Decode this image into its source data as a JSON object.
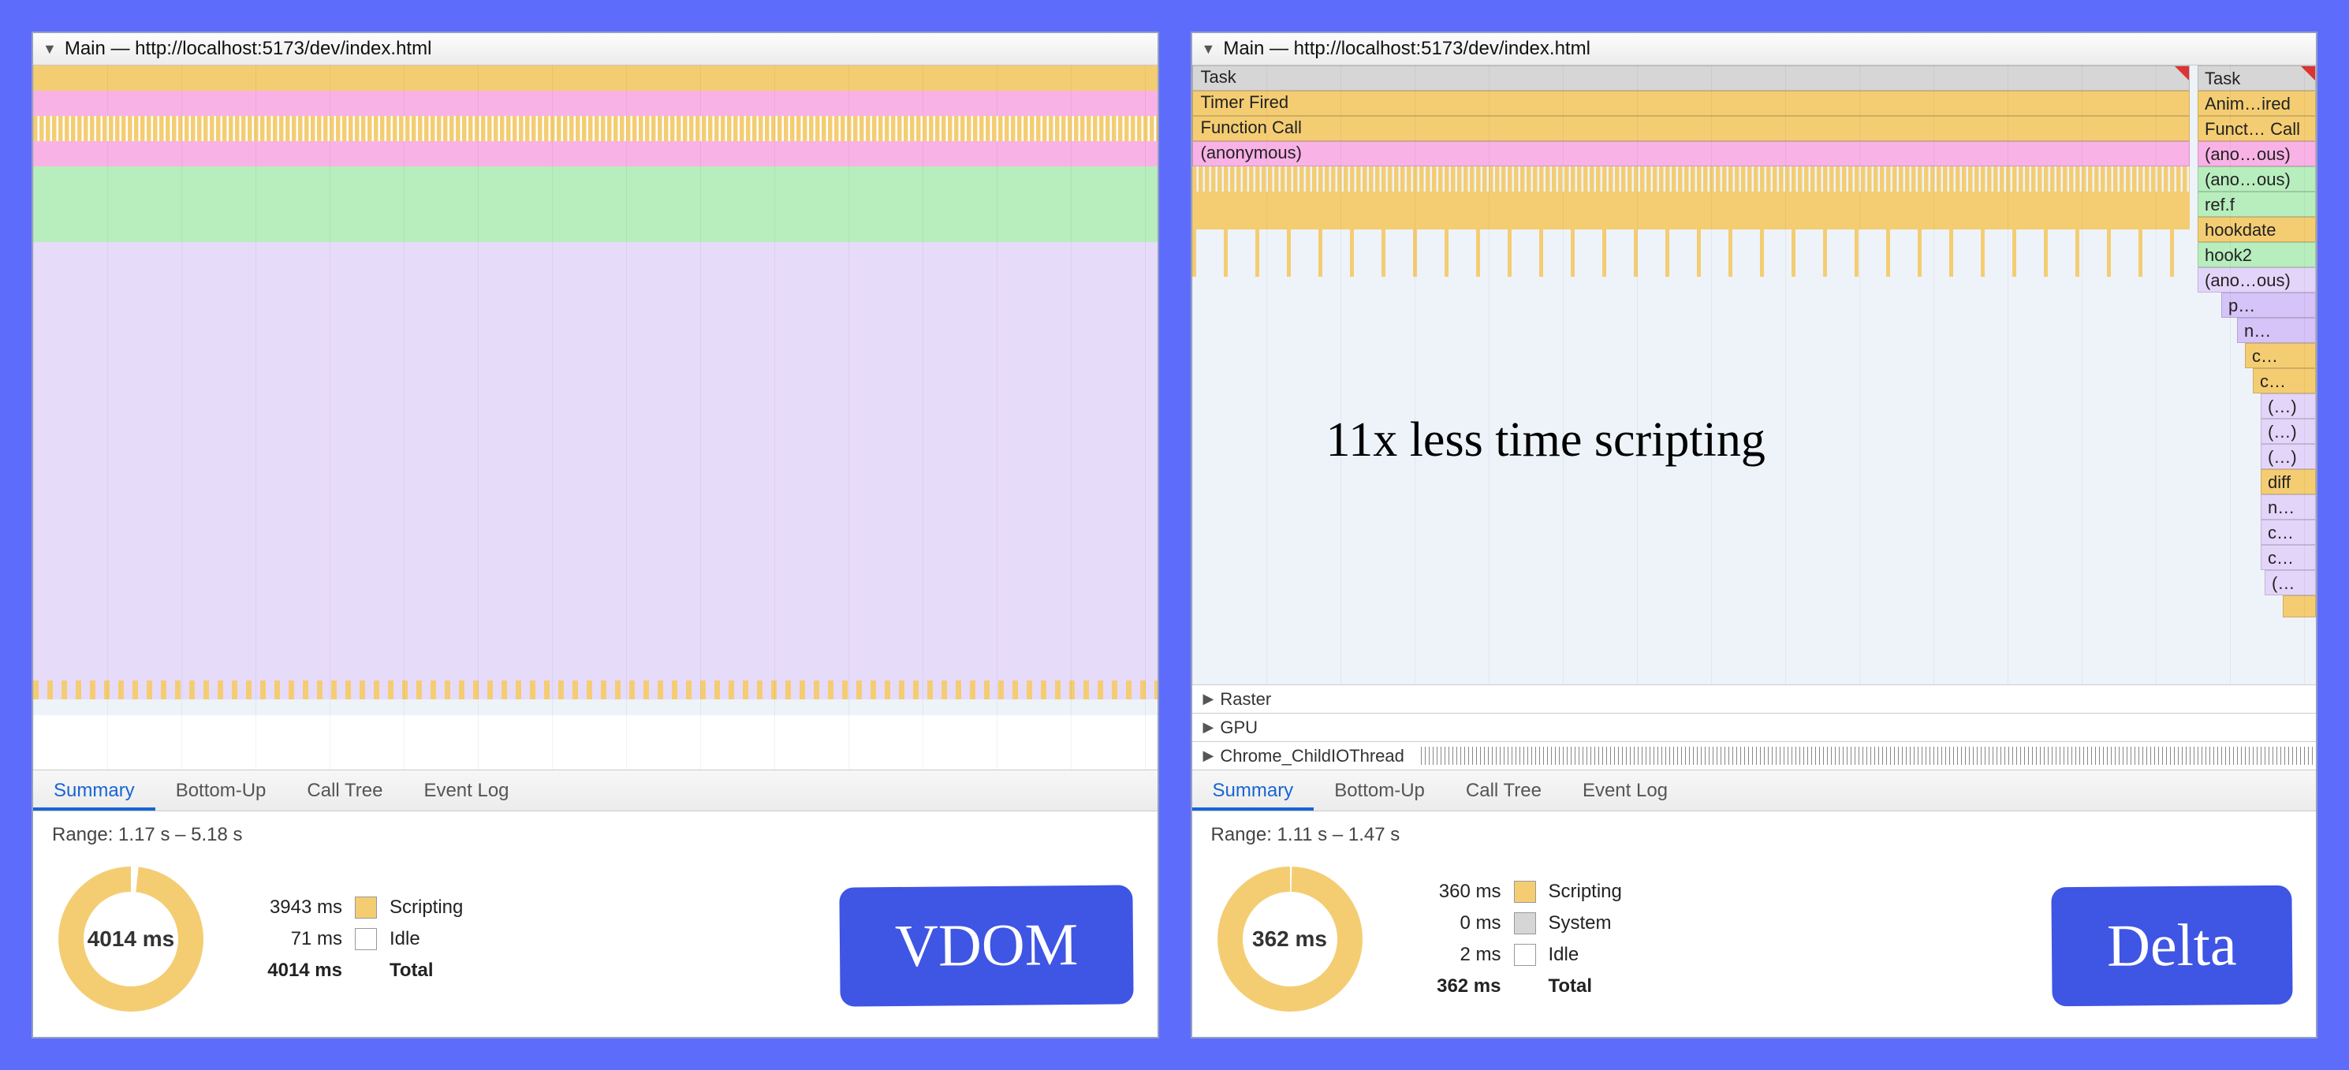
{
  "left": {
    "thread_title": "Main — http://localhost:5173/dev/index.html",
    "tabs": [
      "Summary",
      "Bottom-Up",
      "Call Tree",
      "Event Log"
    ],
    "active_tab": "Summary",
    "range": "Range: 1.17 s – 5.18 s",
    "total_center": "4014 ms",
    "legend": [
      {
        "value": "3943 ms",
        "swatch": "sw-yellow",
        "label": "Scripting"
      },
      {
        "value": "71 ms",
        "swatch": "sw-white",
        "label": "Idle"
      },
      {
        "value": "4014 ms",
        "swatch": "",
        "label": "Total"
      }
    ],
    "badge": "VDOM"
  },
  "right": {
    "thread_title": "Main — http://localhost:5173/dev/index.html",
    "bars": [
      {
        "label": "Task",
        "class": "c-grey"
      },
      {
        "label": "Timer Fired",
        "class": "c-yellow"
      },
      {
        "label": "Function Call",
        "class": "c-yellow"
      },
      {
        "label": "(anonymous)",
        "class": "c-pink"
      }
    ],
    "stack_labels": [
      {
        "label": "Task",
        "class": "c-grey",
        "w": 150
      },
      {
        "label": "Anim…ired",
        "class": "c-yellow",
        "w": 150
      },
      {
        "label": "Funct… Call",
        "class": "c-yellow",
        "w": 150
      },
      {
        "label": "(ano…ous)",
        "class": "c-pink",
        "w": 150
      },
      {
        "label": "(ano…ous)",
        "class": "c-green",
        "w": 150
      },
      {
        "label": "ref.f",
        "class": "c-green",
        "w": 150
      },
      {
        "label": "hookdate",
        "class": "c-yellow",
        "w": 150
      },
      {
        "label": "hook2",
        "class": "c-green",
        "w": 150
      },
      {
        "label": "(ano…ous)",
        "class": "c-vio2",
        "w": 150
      },
      {
        "label": "p…",
        "class": "c-vio",
        "w": 120
      },
      {
        "label": "n…",
        "class": "c-vio",
        "w": 100
      },
      {
        "label": "c…",
        "class": "c-yellow",
        "w": 90
      },
      {
        "label": "c…",
        "class": "c-yellow",
        "w": 80
      },
      {
        "label": "(…)",
        "class": "c-vio2",
        "w": 70
      },
      {
        "label": "(…)",
        "class": "c-vio2",
        "w": 70
      },
      {
        "label": "(…)",
        "class": "c-vio2",
        "w": 70
      },
      {
        "label": "diff",
        "class": "c-yellow",
        "w": 70
      },
      {
        "label": "n…",
        "class": "c-vio2",
        "w": 70
      },
      {
        "label": "c…",
        "class": "c-vio2",
        "w": 70
      },
      {
        "label": "c…",
        "class": "c-vio2",
        "w": 70
      },
      {
        "label": "(…",
        "class": "c-vio2",
        "w": 65
      }
    ],
    "tracks": [
      {
        "label": "Raster",
        "ticks": false
      },
      {
        "label": "GPU",
        "ticks": false
      },
      {
        "label": "Chrome_ChildIOThread",
        "ticks": true
      }
    ],
    "annotation": "11x less time scripting",
    "tabs": [
      "Summary",
      "Bottom-Up",
      "Call Tree",
      "Event Log"
    ],
    "active_tab": "Summary",
    "range": "Range: 1.11 s – 1.47 s",
    "total_center": "362 ms",
    "legend": [
      {
        "value": "360 ms",
        "swatch": "sw-yellow",
        "label": "Scripting"
      },
      {
        "value": "0 ms",
        "swatch": "sw-grey",
        "label": "System"
      },
      {
        "value": "2 ms",
        "swatch": "sw-white",
        "label": "Idle"
      },
      {
        "value": "362 ms",
        "swatch": "",
        "label": "Total"
      }
    ],
    "badge": "Delta"
  },
  "colors": {
    "scripting": "#f4cd73",
    "system": "#d6d6d6",
    "idle": "#ffffff",
    "pink": "#f9b2e6",
    "green": "#b8edbe",
    "violet": "#d6c3f7",
    "accent": "#5e6cfb"
  },
  "chart_data": [
    {
      "type": "pie",
      "title": "VDOM total time",
      "series": [
        {
          "name": "Scripting",
          "value": 3943
        },
        {
          "name": "Idle",
          "value": 71
        }
      ],
      "total": 4014,
      "unit": "ms"
    },
    {
      "type": "pie",
      "title": "Delta total time",
      "series": [
        {
          "name": "Scripting",
          "value": 360
        },
        {
          "name": "System",
          "value": 0
        },
        {
          "name": "Idle",
          "value": 2
        }
      ],
      "total": 362,
      "unit": "ms"
    }
  ]
}
